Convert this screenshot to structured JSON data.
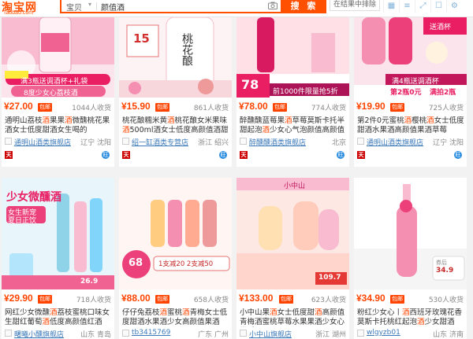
{
  "header": {
    "logo_cn": "淘宝网",
    "logo_en": "Taobao.com",
    "scope": "宝贝",
    "query": "颜值酒",
    "search_button": "搜 索",
    "sub_placeholder": "在结果中排除"
  },
  "row1": [
    {
      "price": "¥27.00",
      "tag": "包邮",
      "sales": "1044人收货",
      "title_pre": "通明山荔枝",
      "title_hl1": "酒",
      "title_mid": "果果",
      "title_hl2": "酒",
      "title_tail": "微醺桃花果酒女士低度甜酒女生喝的",
      "shop": "通明山酒类旗舰店",
      "loc": "辽宁 沈阳",
      "overlay_a": "满3瓶送调酒杯+礼袋",
      "overlay_b": "8度少女心荔枝酒"
    },
    {
      "price": "¥15.90",
      "tag": "包邮",
      "sales": "861人收货",
      "title_pre": "桃花酿糯米黄",
      "title_hl1": "酒",
      "title_mid": "桃花酿女米果味",
      "title_hl2": "酒",
      "title_tail": "500ml酒女士低度高颜值酒甜酒",
      "shop": "绍一缸酒类专营店",
      "loc": "浙江 绍兴",
      "overlay_a": "15",
      "overlay_b": "桃花酿"
    },
    {
      "price": "¥78.00",
      "tag": "包邮",
      "sales": "774人收货",
      "title_pre": "醉醺醺蓝莓果",
      "title_hl1": "酒",
      "title_mid": "草莓莫斯卡托半甜起泡",
      "title_hl2": "酒",
      "title_tail": "少女心气泡颜值高颜值气泡酒",
      "shop": "醉醺醺酒类旗舰店",
      "loc": "北京",
      "overlay_a": "78",
      "overlay_b": "前1000件限量抢5折"
    },
    {
      "price": "¥19.90",
      "tag": "包邮",
      "sales": "725人收货",
      "title_pre": "第2件0元蜜桃",
      "title_hl1": "酒",
      "title_mid": "樱桃",
      "title_hl2": "酒",
      "title_tail": "女士低度甜酒水果酒高颜值果酒草莓",
      "shop": "通明山酒类旗舰店",
      "loc": "辽宁 沈阳",
      "overlay_a": "送酒杯",
      "overlay_b": "满4瓶送调酒杯",
      "overlay_c": "第2瓶0元",
      "overlay_d": "满拍2瓶"
    }
  ],
  "row2": [
    {
      "price": "¥29.90",
      "tag": "包邮",
      "sales": "718人收货",
      "title_pre": "网红少女微醺",
      "title_hl1": "酒",
      "title_mid": "荔枝蜜桃口味女生甜红葡萄",
      "title_hl2": "酒",
      "title_tail": "低度高颜值红酒",
      "shop": "曙曦小醺旗舰店",
      "loc": "山东 青岛",
      "overlay_a": "少女微醺酒",
      "overlay_b": "女生新宠 夏日正饮",
      "overlay_c": "26.9"
    },
    {
      "price": "¥88.00",
      "tag": "包邮",
      "sales": "658人收货",
      "title_pre": "仔仔兔荔枝",
      "title_hl1": "酒",
      "title_mid": "蜜桃",
      "title_hl2": "酒",
      "title_tail": "青梅女士低度甜酒水果酒少女高颜值果酒",
      "shop": "tb3415769",
      "loc": "广东 广州",
      "overlay_a": "68",
      "overlay_b": "1支减20 2支减50"
    },
    {
      "price": "¥133.00",
      "tag": "包邮",
      "sales": "623人收货",
      "title_pre": "小中山果",
      "title_hl1": "酒",
      "title_mid": "女士低度甜",
      "title_hl2": "酒",
      "title_tail": "高颜值青梅酒蜜桃草莓水果果酒少女心微醺",
      "shop": "小中山旗舰店",
      "loc": "浙江 湖州",
      "overlay_a": "109.7",
      "overlay_b": "小中山"
    },
    {
      "price": "¥34.90",
      "tag": "包邮",
      "sales": "530人收货",
      "title_pre": "粉红少女心丨",
      "title_hl1": "酒",
      "title_mid": "西班牙玫瑰花香 莫斯卡托桃红起泡",
      "title_hl2": "酒",
      "title_tail": "少女甜酒",
      "shop": "wlgyzb01",
      "loc": "山东 济南",
      "overlay_a": "34.9",
      "overlay_b": "券后"
    }
  ]
}
